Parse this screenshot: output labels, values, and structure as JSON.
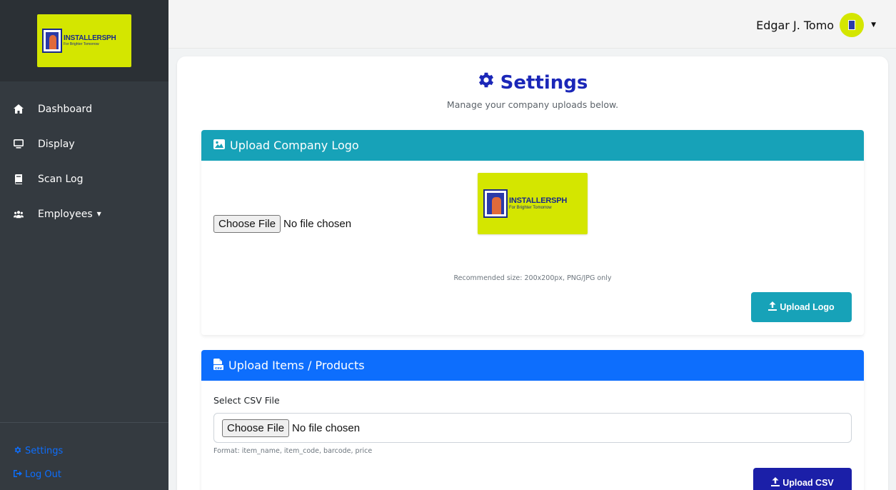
{
  "brand": {
    "line1": "INSTALLERSPH",
    "line2": "For Brighter Tomorrow"
  },
  "sidebar": {
    "items": [
      {
        "label": "Dashboard",
        "icon": "home-icon"
      },
      {
        "label": "Display",
        "icon": "monitor-icon"
      },
      {
        "label": "Scan Log",
        "icon": "book-icon"
      },
      {
        "label": "Employees",
        "icon": "users-icon"
      }
    ],
    "footer": {
      "settings": "Settings",
      "logout": "Log Out"
    }
  },
  "header": {
    "user_name": "Edgar J. Tomo"
  },
  "page": {
    "title": "Settings",
    "subtitle": "Manage your company uploads below."
  },
  "logo_section": {
    "title": "Upload Company Logo",
    "file_button": "Choose File",
    "file_status": "No file chosen",
    "hint": "Recommended size: 200x200px, PNG/JPG only",
    "submit": "Upload Logo"
  },
  "csv_section": {
    "title": "Upload Items / Products",
    "label": "Select CSV File",
    "file_button": "Choose File",
    "file_status": "No file chosen",
    "hint": "Format: item_name, item_code, barcode, price",
    "submit": "Upload CSV"
  },
  "colors": {
    "sidebar": "#343a40",
    "brand_yellow": "#d4e600",
    "logo_header": "#17a2b8",
    "csv_header": "#0d6efd",
    "title_blue": "#1b27b8",
    "csv_button": "#1b1fa8"
  }
}
